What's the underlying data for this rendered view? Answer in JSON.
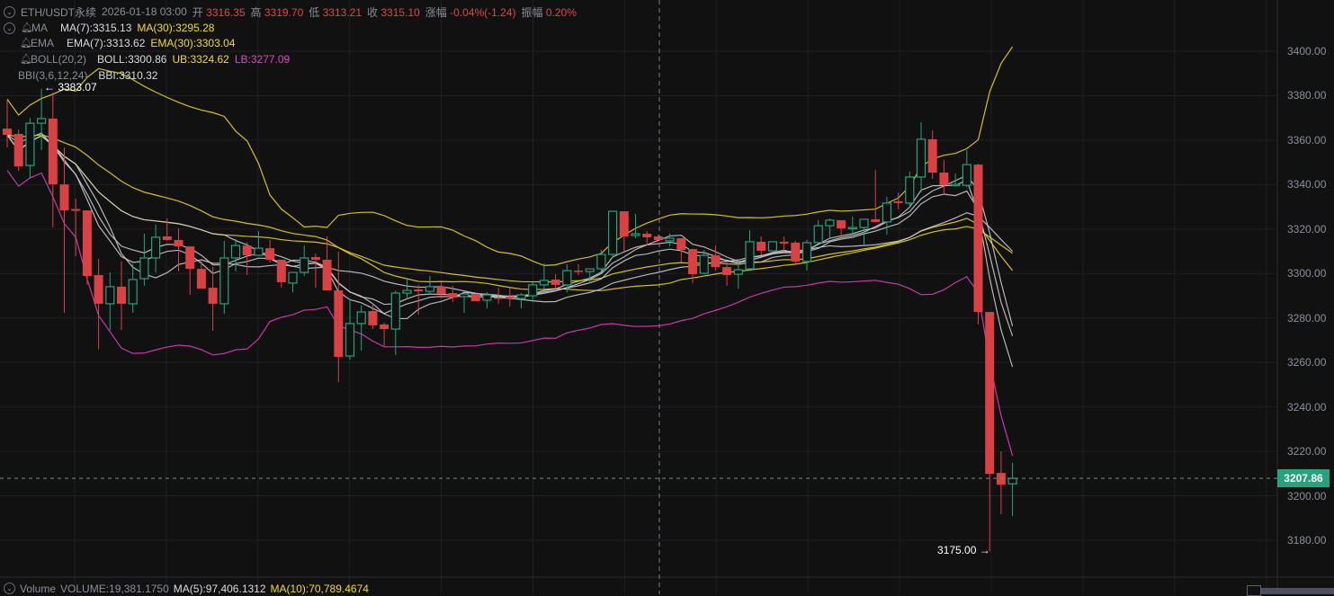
{
  "header": {
    "symbol": "ETH/USDT永续",
    "datetime": "2026-01-18 03:00",
    "open_label": "开",
    "open": "3316.35",
    "high_label": "高",
    "high": "3319.70",
    "low_label": "低",
    "low": "3313.21",
    "close_label": "收",
    "close": "3315.10",
    "change_label": "涨幅",
    "change": "-0.04%(-1.24)",
    "amplitude_label": "振幅",
    "amplitude": "0.20%"
  },
  "indicators": {
    "ma": {
      "name": "MA",
      "ma7": "MA(7):3315.13",
      "ma30": "MA(30):3295.28"
    },
    "ema": {
      "name": "EMA",
      "ema7": "EMA(7):3313.62",
      "ema30": "EMA(30):3303.04"
    },
    "boll": {
      "name": "BOLL(20,2)",
      "mid": "BOLL:3300.86",
      "ub": "UB:3324.62",
      "lb": "LB:3277.09"
    },
    "bbi": {
      "name": "BBI(3,6,12,24)",
      "value": "BBI:3310.32"
    }
  },
  "volume": {
    "name": "Volume",
    "value": "VOLUME:19,381.1750",
    "ma5": "MA(5):97,406.1312",
    "ma10": "MA(10):70,789.4674"
  },
  "colors": {
    "up": "#26a27d",
    "down": "#d94144",
    "yellow": "#e8d41c",
    "magenta": "#d93fb8",
    "white": "#c8c9cc"
  },
  "chart_data": {
    "type": "candlestick",
    "title": "ETH/USDT永续",
    "y_ticks": [
      "3400.00",
      "3380.00",
      "3360.00",
      "3340.00",
      "3320.00",
      "3300.00",
      "3280.00",
      "3260.00",
      "3240.00",
      "3220.00",
      "3200.00",
      "3180.00"
    ],
    "ylim": [
      3170,
      3420
    ],
    "current_price": "3207.86",
    "high_marker": "← 3383.07",
    "low_marker": "3175.00 →",
    "grid": true,
    "ohlc": [
      [
        3365.2,
        3377.8,
        3356.7,
        3362.4
      ],
      [
        3362.8,
        3364.8,
        3346.2,
        3348.2
      ],
      [
        3348.6,
        3370,
        3343,
        3367.6
      ],
      [
        3367.6,
        3383.07,
        3355.5,
        3369.7
      ],
      [
        3369.7,
        3381.4,
        3320.7,
        3340.1
      ],
      [
        3340.1,
        3356.7,
        3282.3,
        3328.4
      ],
      [
        3329,
        3333.7,
        3307.8,
        3328.2
      ],
      [
        3328.4,
        3328.4,
        3294.9,
        3298.9
      ],
      [
        3299.3,
        3306.6,
        3266,
        3286.4
      ],
      [
        3286.4,
        3300.5,
        3274.6,
        3294.1
      ],
      [
        3294.1,
        3305.4,
        3274.6,
        3286.4
      ],
      [
        3286.4,
        3304.2,
        3282.3,
        3297.3
      ],
      [
        3297.7,
        3317.9,
        3294.5,
        3307
      ],
      [
        3307,
        3322,
        3300.5,
        3316.3
      ],
      [
        3316.7,
        3324.8,
        3314.7,
        3315.1
      ],
      [
        3315.1,
        3320.3,
        3301,
        3312.2
      ],
      [
        3312.2,
        3312.2,
        3290.4,
        3302.1
      ],
      [
        3302.1,
        3306,
        3293.2,
        3293.2
      ],
      [
        3293.6,
        3303,
        3274.2,
        3286.4
      ],
      [
        3286.4,
        3314.7,
        3281.9,
        3307
      ],
      [
        3307,
        3315.5,
        3301,
        3312.6
      ],
      [
        3312.6,
        3314,
        3299.3,
        3308.2
      ],
      [
        3308.2,
        3319.1,
        3308.2,
        3311.4
      ],
      [
        3311.4,
        3315.1,
        3305,
        3306.2
      ],
      [
        3306.2,
        3306.2,
        3293.6,
        3296.1
      ],
      [
        3295.7,
        3300.1,
        3291.6,
        3300.5
      ],
      [
        3300.5,
        3312.6,
        3298.9,
        3307
      ],
      [
        3307.4,
        3309,
        3293.6,
        3306.2
      ],
      [
        3306.2,
        3316.7,
        3292.4,
        3292.4
      ],
      [
        3292.4,
        3309.8,
        3251.2,
        3262.5
      ],
      [
        3262.9,
        3288.4,
        3261.3,
        3277.5
      ],
      [
        3277.5,
        3285.6,
        3265.3,
        3282.7
      ],
      [
        3283.1,
        3286.8,
        3275,
        3276.7
      ],
      [
        3277.1,
        3277.9,
        3267.4,
        3275
      ],
      [
        3275,
        3292.4,
        3263.3,
        3291.2
      ],
      [
        3291.2,
        3298.1,
        3289.2,
        3292.4
      ],
      [
        3292.8,
        3295,
        3281.5,
        3292
      ],
      [
        3292,
        3298.9,
        3290.5,
        3294.1
      ],
      [
        3294.1,
        3296,
        3288.8,
        3290.8
      ],
      [
        3291.2,
        3294.5,
        3287.2,
        3289.2
      ],
      [
        3289.6,
        3291.2,
        3282.3,
        3290.8
      ],
      [
        3290.8,
        3291.2,
        3287.6,
        3287.6
      ],
      [
        3288,
        3291.6,
        3284.3,
        3290.4
      ],
      [
        3289.2,
        3293.7,
        3286.4,
        3288.8
      ],
      [
        3289.6,
        3293.4,
        3285.1,
        3288.8
      ],
      [
        3288.8,
        3291.2,
        3284.3,
        3290.4
      ],
      [
        3290,
        3296.1,
        3287.2,
        3294.9
      ],
      [
        3294.9,
        3304.6,
        3292.8,
        3296.9
      ],
      [
        3297.3,
        3299.7,
        3293.2,
        3294.9
      ],
      [
        3294.9,
        3304.2,
        3291.6,
        3301.3
      ],
      [
        3301.3,
        3304.2,
        3299.3,
        3300.9
      ],
      [
        3300.9,
        3302.1,
        3295.7,
        3302.1
      ],
      [
        3302.1,
        3310.6,
        3300.9,
        3308.6
      ],
      [
        3308.6,
        3328,
        3307,
        3328
      ],
      [
        3328,
        3328,
        3309.8,
        3316.7
      ],
      [
        3317.1,
        3326.8,
        3315.9,
        3317.9
      ],
      [
        3317.9,
        3319.1,
        3312.6,
        3316.3
      ],
      [
        3316.7,
        3317.5,
        3315.1,
        3315.1
      ],
      [
        3314.7,
        3318,
        3312.2,
        3315.9
      ],
      [
        3315.9,
        3315.9,
        3305,
        3310.6
      ],
      [
        3311,
        3311,
        3295.7,
        3299.7
      ],
      [
        3300.1,
        3310.6,
        3299.7,
        3308.2
      ],
      [
        3308.2,
        3312.6,
        3301.3,
        3302.9
      ],
      [
        3302.9,
        3305,
        3294.5,
        3299.3
      ],
      [
        3299.7,
        3306.2,
        3293.2,
        3301.7
      ],
      [
        3302.1,
        3319.5,
        3302.1,
        3314.3
      ],
      [
        3314.3,
        3316.7,
        3308.2,
        3310.2
      ],
      [
        3310.2,
        3314.3,
        3310.2,
        3314.3
      ],
      [
        3314.3,
        3316.7,
        3310.2,
        3313.5
      ],
      [
        3313.9,
        3314.7,
        3304.6,
        3305.4
      ],
      [
        3305.4,
        3315.1,
        3301.3,
        3313.9
      ],
      [
        3313.9,
        3324,
        3313.9,
        3321.5
      ],
      [
        3321.5,
        3324.8,
        3315.9,
        3324
      ],
      [
        3324,
        3324,
        3317.5,
        3320.3
      ],
      [
        3320.3,
        3325.6,
        3316.3,
        3320.7
      ],
      [
        3320.7,
        3324.4,
        3312.6,
        3324.4
      ],
      [
        3324.4,
        3346.6,
        3323.2,
        3323.2
      ],
      [
        3323.2,
        3334.5,
        3317.5,
        3331.7
      ],
      [
        3332.5,
        3336.4,
        3328.8,
        3331.7
      ],
      [
        3331.7,
        3345.8,
        3329.7,
        3343.4
      ],
      [
        3343.4,
        3368,
        3336.6,
        3360.4
      ],
      [
        3360.4,
        3364.4,
        3342.6,
        3345.4
      ],
      [
        3345.4,
        3351,
        3335.3,
        3339.7
      ],
      [
        3339.7,
        3345,
        3339.7,
        3340.1
      ],
      [
        3339.7,
        3355.5,
        3338.9,
        3349
      ],
      [
        3349,
        3349.4,
        3277.1,
        3282.7
      ],
      [
        3282.7,
        3282.7,
        3175,
        3209.9
      ],
      [
        3210.3,
        3220,
        3191.7,
        3205
      ],
      [
        3205.4,
        3214.8,
        3190.9,
        3207.86
      ]
    ]
  }
}
